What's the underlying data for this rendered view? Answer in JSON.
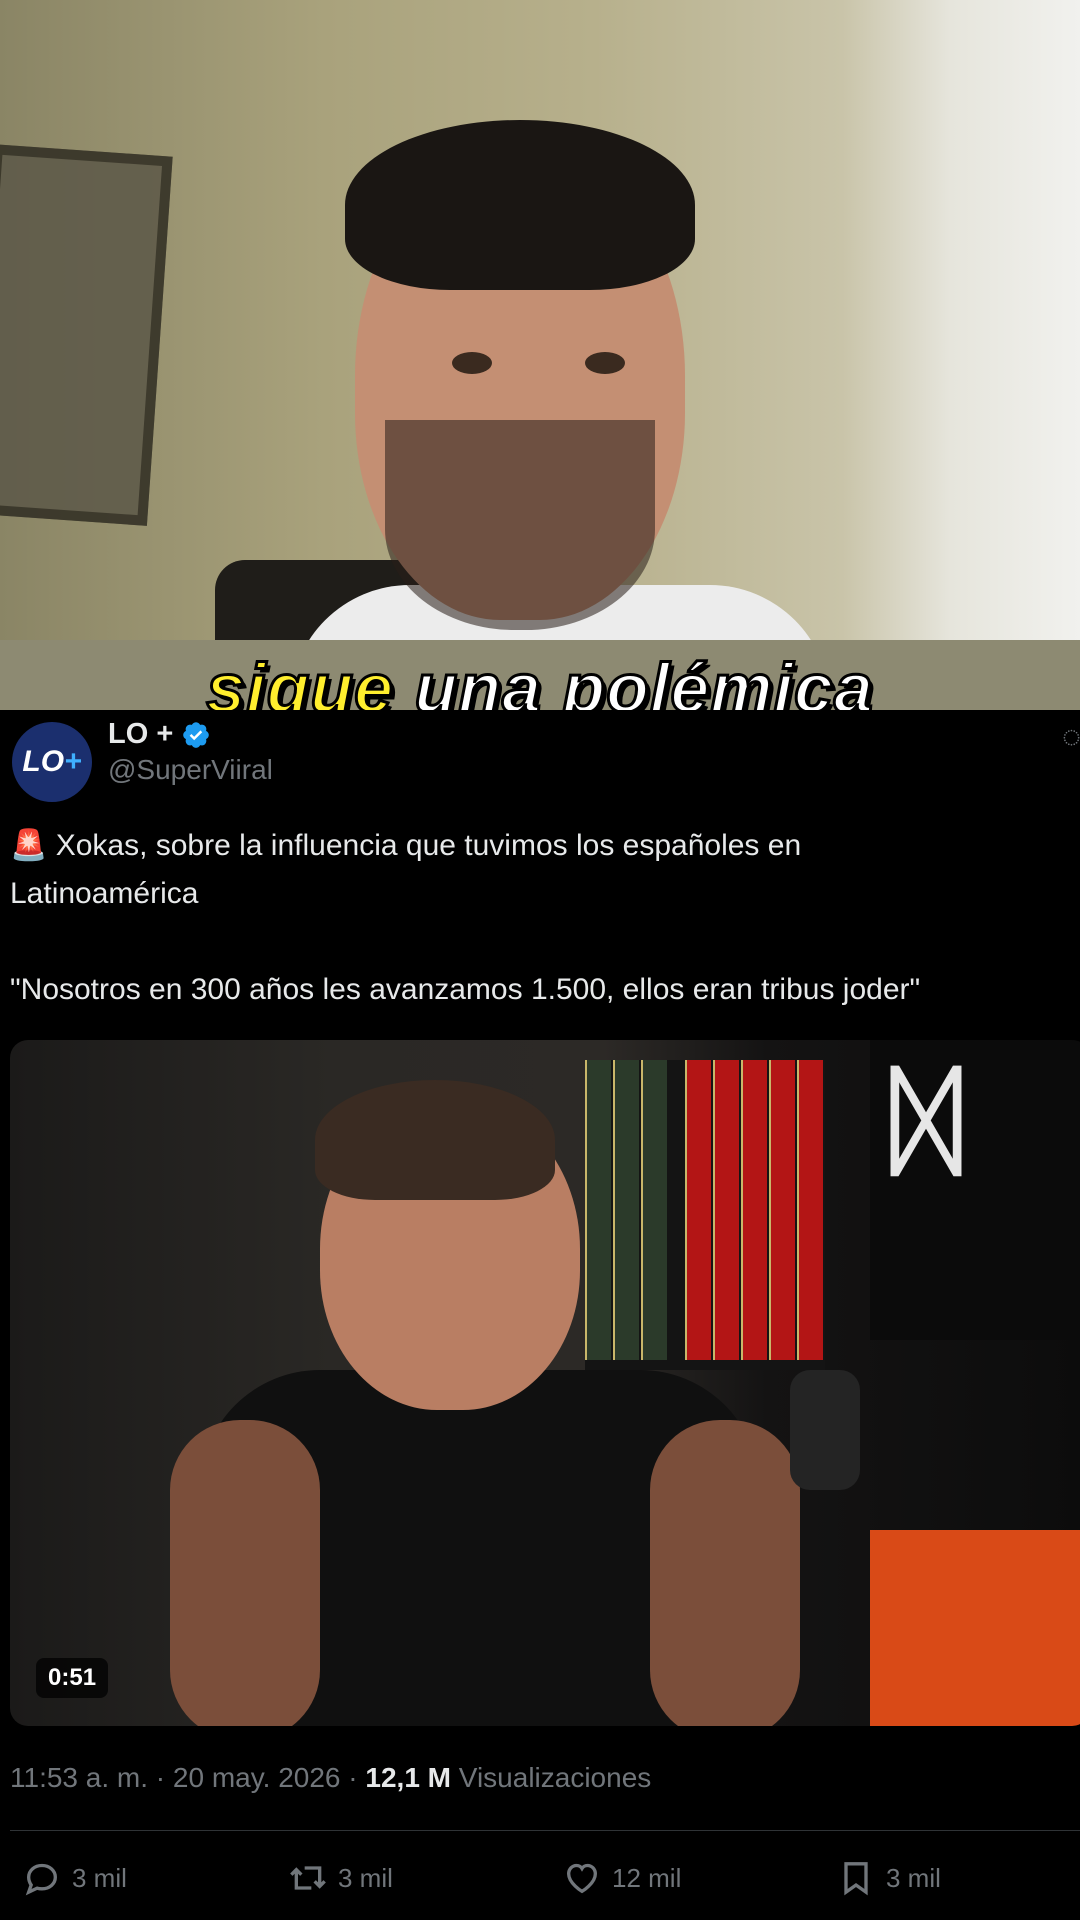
{
  "subtitle": {
    "highlight": "sigue",
    "rest": " una polémica"
  },
  "tweet": {
    "display_name": "LO +",
    "handle": "@SuperViiral",
    "avatar_text": "LO",
    "avatar_plus": "+",
    "alert_emoji": "🚨",
    "text_line1": " Xokas, sobre la influencia que tuvimos los españoles en\nLatinoamérica\n\n\"Nosotros en 300 años les avanzamos 1.500, ellos eran tribus joder\"",
    "media": {
      "duration": "0:51"
    },
    "time": "11:53 a. m.",
    "date": "20 may. 2026",
    "views_count": "12,1 M",
    "views_label": "Visualizaciones",
    "sep": "·",
    "actions": {
      "replies": "3 mil",
      "reposts": "3 mil",
      "likes": "12 mil",
      "bookmarks": "3 mil"
    }
  },
  "colors": {
    "background": "#000000",
    "text": "#e7e9ea",
    "secondary": "#71767b",
    "verified": "#1d9bf0",
    "subtitle_highlight": "#ffee2e"
  },
  "icons": [
    "verified-badge-icon",
    "grok-icon",
    "reply-icon",
    "repost-icon",
    "like-icon",
    "bookmark-icon"
  ]
}
